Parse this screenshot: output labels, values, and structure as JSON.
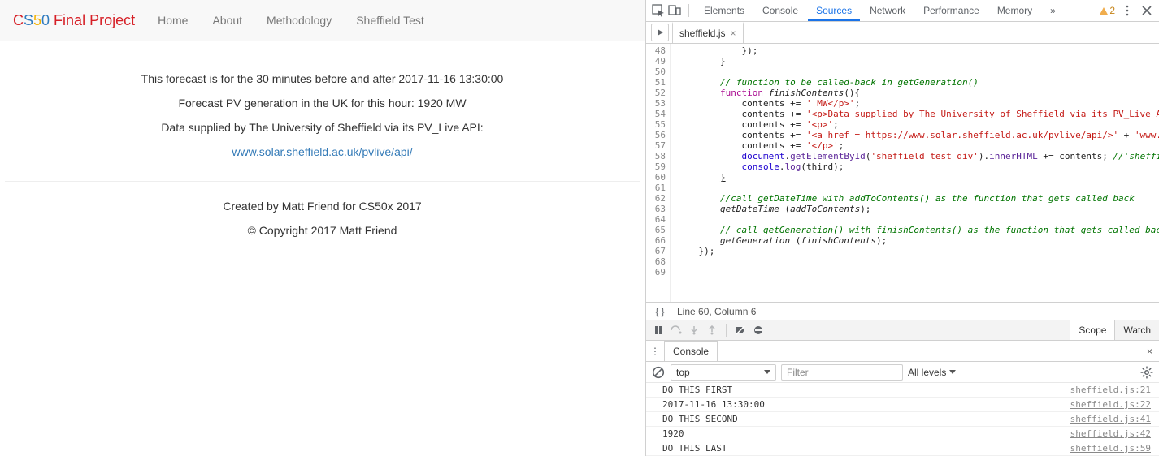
{
  "page": {
    "brand_chars": [
      "C",
      "S",
      "5",
      "0"
    ],
    "brand_rest": " Final Project",
    "nav": [
      "Home",
      "About",
      "Methodology",
      "Sheffield Test"
    ],
    "line1": "This forecast is for the 30 minutes before and after 2017-11-16 13:30:00",
    "line2": "Forecast PV generation in the UK for this hour: 1920 MW",
    "line3": "Data supplied by The University of Sheffield via its PV_Live API:",
    "link": "www.solar.sheffield.ac.uk/pvlive/api/",
    "footer1": "Created by Matt Friend for CS50x 2017",
    "footer2": "© Copyright 2017 Matt Friend"
  },
  "devtools": {
    "tabs": [
      "Elements",
      "Console",
      "Sources",
      "Network",
      "Performance",
      "Memory"
    ],
    "active_tab": "Sources",
    "more": "»",
    "warn_count": "2",
    "file_tab": "sheffield.js",
    "status": "Line 60, Column 6",
    "scope_label": "Scope",
    "watch_label": "Watch",
    "console_label": "Console",
    "context": "top",
    "filter_placeholder": "Filter",
    "levels": "All levels",
    "code_lines": [
      {
        "n": 48,
        "html": "            });"
      },
      {
        "n": 49,
        "html": "        }"
      },
      {
        "n": 50,
        "html": ""
      },
      {
        "n": 51,
        "html": "        <span class='tok-com'>// function to be called-back in getGeneration()</span>"
      },
      {
        "n": 52,
        "html": "        <span class='tok-kw'>function</span> <span class='tok-fn'>finishContents</span>(){"
      },
      {
        "n": 53,
        "html": "            contents += <span class='tok-str'>' MW&lt;/p&gt;'</span>;"
      },
      {
        "n": 54,
        "html": "            contents += <span class='tok-str'>'&lt;p&gt;Data supplied by The University of Sheffield via its PV_Live API:&lt;</span>"
      },
      {
        "n": 55,
        "html": "            contents += <span class='tok-str'>'&lt;p&gt;'</span>;"
      },
      {
        "n": 56,
        "html": "            contents += <span class='tok-str'>'&lt;a href = https://www.solar.sheffield.ac.uk/pvlive/api/&gt;'</span> + <span class='tok-str'>'www.sola</span>"
      },
      {
        "n": 57,
        "html": "            contents += <span class='tok-str'>'&lt;/p&gt;'</span>;"
      },
      {
        "n": 58,
        "html": "            <span class='tok-lit'>document</span>.<span class='tok-prop'>getElementById</span>(<span class='tok-str'>'sheffield_test_div'</span>).<span class='tok-prop'>innerHTML</span> += contents; <span class='tok-com'>//'sheffield_</span>"
      },
      {
        "n": 59,
        "html": "            <span class='tok-lit'>console</span>.<span class='tok-prop'>log</span>(third);"
      },
      {
        "n": 60,
        "html": "        <u>}</u>"
      },
      {
        "n": 61,
        "html": ""
      },
      {
        "n": 62,
        "html": "        <span class='tok-com'>//call getDateTime with addToContents() as the function that gets called back</span>"
      },
      {
        "n": 63,
        "html": "        <span class='tok-fn'>getDateTime</span> (<span class='tok-fn'>addToContents</span>);"
      },
      {
        "n": 64,
        "html": ""
      },
      {
        "n": 65,
        "html": "        <span class='tok-com'>// call getGeneration() with finishContents() as the function that gets called back</span>"
      },
      {
        "n": 66,
        "html": "        <span class='tok-fn'>getGeneration</span> (<span class='tok-fn'>finishContents</span>);"
      },
      {
        "n": 67,
        "html": "    });"
      },
      {
        "n": 68,
        "html": ""
      },
      {
        "n": 69,
        "html": ""
      }
    ],
    "console_rows": [
      {
        "msg": "DO THIS FIRST",
        "src": "sheffield.js:21"
      },
      {
        "msg": "2017-11-16 13:30:00",
        "src": "sheffield.js:22"
      },
      {
        "msg": "DO THIS SECOND",
        "src": "sheffield.js:41"
      },
      {
        "msg": "1920",
        "src": "sheffield.js:42"
      },
      {
        "msg": "DO THIS LAST",
        "src": "sheffield.js:59"
      }
    ]
  }
}
